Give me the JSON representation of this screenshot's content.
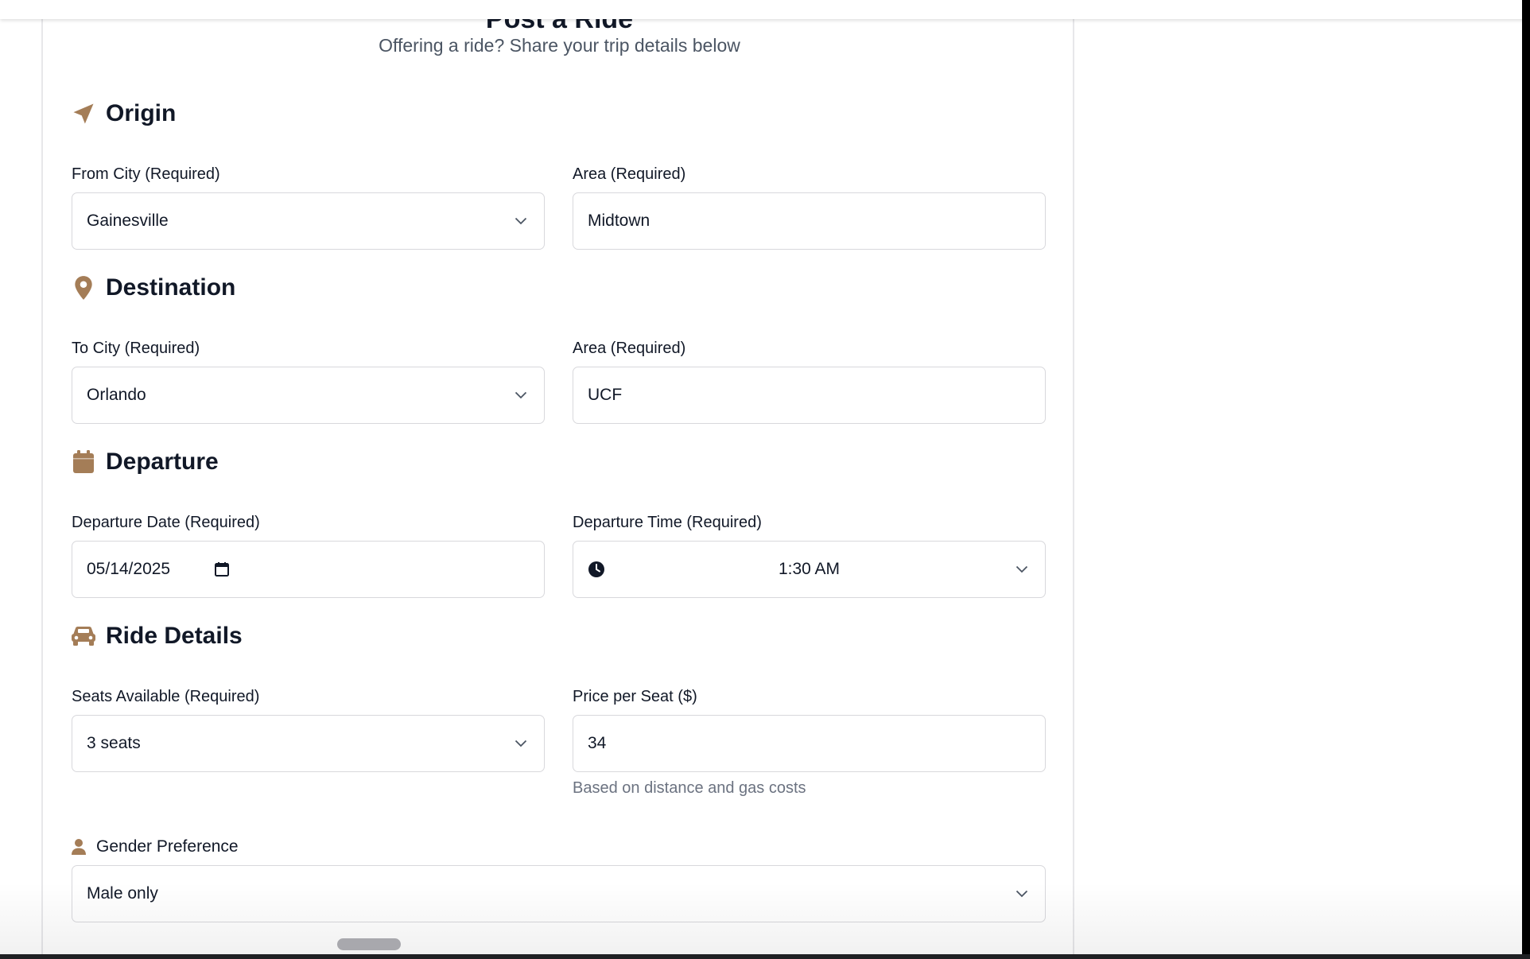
{
  "header": {
    "title": "Post a Ride",
    "subtitle": "Offering a ride? Share your trip details below"
  },
  "colors": {
    "accent": "#a47d57",
    "border": "#d8d8dc",
    "muted": "#6b7280"
  },
  "origin": {
    "title": "Origin",
    "icon": "location-arrow-icon",
    "from_city_label": "From City (Required)",
    "from_city_value": "Gainesville",
    "area_label": "Area (Required)",
    "area_value": "Midtown"
  },
  "destination": {
    "title": "Destination",
    "icon": "map-pin-icon",
    "to_city_label": "To City (Required)",
    "to_city_value": "Orlando",
    "area_label": "Area (Required)",
    "area_value": "UCF"
  },
  "departure": {
    "title": "Departure",
    "icon": "calendar-icon",
    "date_label": "Departure Date (Required)",
    "date_value": "05/14/2025",
    "time_label": "Departure Time (Required)",
    "time_value": "1:30 AM"
  },
  "ride_details": {
    "title": "Ride Details",
    "icon": "car-icon",
    "seats_label": "Seats Available (Required)",
    "seats_value": "3 seats",
    "price_label": "Price per Seat ($)",
    "price_value": "34",
    "price_hint": "Based on distance and gas costs"
  },
  "gender": {
    "label": "Gender Preference",
    "icon": "person-icon",
    "value": "Male only"
  }
}
